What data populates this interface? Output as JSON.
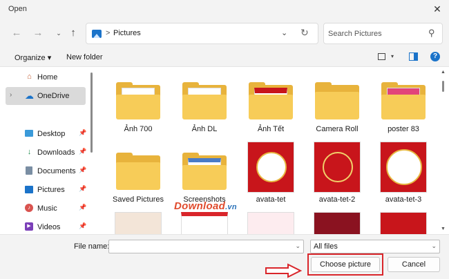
{
  "window": {
    "title": "Open"
  },
  "nav": {
    "back_icon": "arrow-left-icon",
    "forward_icon": "arrow-right-icon",
    "up_icon": "arrow-up-icon",
    "crumb_separator": ">",
    "location": "Pictures",
    "search_placeholder": "Search Pictures"
  },
  "toolbar": {
    "organize_label": "Organize ▾",
    "new_folder_label": "New folder"
  },
  "sidebar": {
    "items": [
      {
        "label": "Home",
        "icon": "home-icon"
      },
      {
        "label": "OneDrive",
        "icon": "cloud-icon"
      },
      {
        "label": "Desktop",
        "icon": "desktop-icon"
      },
      {
        "label": "Downloads",
        "icon": "download-icon"
      },
      {
        "label": "Documents",
        "icon": "document-icon"
      },
      {
        "label": "Pictures",
        "icon": "pictures-icon"
      },
      {
        "label": "Music",
        "icon": "music-icon"
      },
      {
        "label": "Videos",
        "icon": "video-icon"
      }
    ]
  },
  "files": [
    {
      "name": "Ảnh 700",
      "kind": "folder"
    },
    {
      "name": "Ảnh DL",
      "kind": "folder"
    },
    {
      "name": "Ảnh Tết",
      "kind": "folder"
    },
    {
      "name": "Camera Roll",
      "kind": "folder"
    },
    {
      "name": "poster 83",
      "kind": "folder"
    },
    {
      "name": "Saved Pictures",
      "kind": "folder"
    },
    {
      "name": "Screenshots",
      "kind": "folder"
    },
    {
      "name": "avata-tet",
      "kind": "image"
    },
    {
      "name": "avata-tet-2",
      "kind": "image"
    },
    {
      "name": "avata-tet-3",
      "kind": "image"
    }
  ],
  "watermark": {
    "brand": "Download",
    "tld": ".vn"
  },
  "footer": {
    "file_name_label": "File name:",
    "file_name_value": "",
    "filter_value": "All files",
    "choose_label": "Choose picture",
    "cancel_label": "Cancel"
  },
  "colors": {
    "accent": "#1b73c9",
    "folder": "#f7cc58",
    "highlight": "#d9252a",
    "tet_red": "#c8151b"
  }
}
